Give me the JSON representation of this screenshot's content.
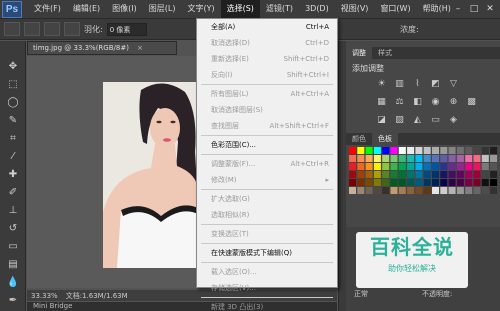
{
  "app": {
    "logo": "Ps"
  },
  "menu": [
    {
      "label": "文件(F)"
    },
    {
      "label": "编辑(E)"
    },
    {
      "label": "图像(I)"
    },
    {
      "label": "图层(L)"
    },
    {
      "label": "文字(Y)"
    },
    {
      "label": "选择(S)"
    },
    {
      "label": "滤镜(T)"
    },
    {
      "label": "3D(D)"
    },
    {
      "label": "视图(V)"
    },
    {
      "label": "窗口(W)"
    },
    {
      "label": "帮助(H)"
    }
  ],
  "options": {
    "feather_label": "羽化:",
    "feather_value": "0 像素",
    "opacity_label": "浓度:"
  },
  "document": {
    "tab_title": "timg.jpg @ 33.3%(RGB/8#)",
    "close": "×"
  },
  "status": {
    "zoom": "33.33%",
    "doc_info": "文档:1.63M/1.63M"
  },
  "mini_bridge": {
    "label": "Mini Bridge"
  },
  "dropdown": {
    "items": [
      {
        "label": "全部(A)",
        "shortcut": "Ctrl+A",
        "disabled": false
      },
      {
        "label": "取消选择(D)",
        "shortcut": "Ctrl+D",
        "disabled": true
      },
      {
        "label": "重新选择(E)",
        "shortcut": "Shift+Ctrl+D",
        "disabled": true
      },
      {
        "label": "反向(I)",
        "shortcut": "Shift+Ctrl+I",
        "disabled": true
      },
      {
        "sep": true
      },
      {
        "label": "所有图层(L)",
        "shortcut": "Alt+Ctrl+A",
        "disabled": true
      },
      {
        "label": "取消选择图层(S)",
        "shortcut": "",
        "disabled": true
      },
      {
        "label": "查找图层",
        "shortcut": "Alt+Shift+Ctrl+F",
        "disabled": true
      },
      {
        "sep": true
      },
      {
        "label": "色彩范围(C)...",
        "shortcut": "",
        "disabled": false
      },
      {
        "sep": true
      },
      {
        "label": "调整蒙版(F)...",
        "shortcut": "Alt+Ctrl+R",
        "disabled": true
      },
      {
        "label": "修改(M)",
        "shortcut": "▸",
        "disabled": true
      },
      {
        "sep": true
      },
      {
        "label": "扩大选取(G)",
        "shortcut": "",
        "disabled": true
      },
      {
        "label": "选取相似(R)",
        "shortcut": "",
        "disabled": true
      },
      {
        "sep": true
      },
      {
        "label": "变换选区(T)",
        "shortcut": "",
        "disabled": true
      },
      {
        "sep": true
      },
      {
        "label": "在快速蒙版模式下编辑(Q)",
        "shortcut": "",
        "disabled": false
      },
      {
        "sep": true
      },
      {
        "label": "载入选区(O)...",
        "shortcut": "",
        "disabled": true
      },
      {
        "label": "存储选区(V)...",
        "shortcut": "",
        "disabled": true
      },
      {
        "sep": true
      },
      {
        "label": "新建 3D 凸出(3)",
        "shortcut": "",
        "disabled": true
      }
    ]
  },
  "panels": {
    "tabs_top": [
      "调整",
      "样式"
    ],
    "adjust_title": "添加调整",
    "tabs_mid": [
      "颜色",
      "色板"
    ],
    "blend_mode": "正常",
    "opacity_label": "不透明度:"
  },
  "watermark": {
    "big": "百科全说",
    "small": "助你轻松解决"
  },
  "colors": {
    "accent_menu": "#1f1f1f",
    "watermark": "#2bb19a"
  }
}
